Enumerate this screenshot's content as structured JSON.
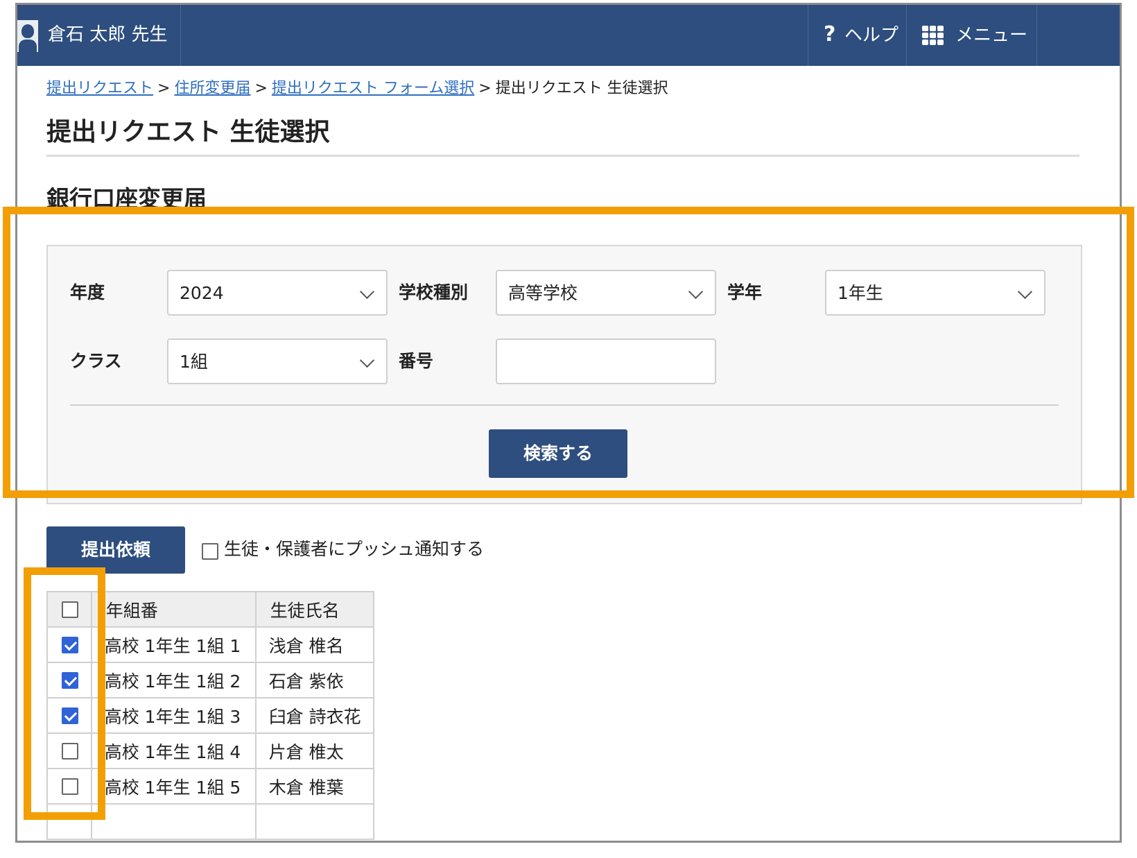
{
  "header": {
    "user_name": "倉石 太郎 先生",
    "help_icon": "?",
    "help_label": "ヘルプ",
    "menu_label": "メニュー"
  },
  "breadcrumb": {
    "items": [
      "提出リクエスト",
      "住所変更届",
      "提出リクエスト フォーム選択"
    ],
    "current": "提出リクエスト 生徒選択",
    "separator": ">"
  },
  "page": {
    "title": "提出リクエスト 生徒選択",
    "form_title": "銀行口座変更届"
  },
  "search": {
    "year_label": "年度",
    "year_value": "2024",
    "school_type_label": "学校種別",
    "school_type_value": "高等学校",
    "grade_label": "学年",
    "grade_value": "1年生",
    "class_label": "クラス",
    "class_value": "1組",
    "number_label": "番号",
    "number_value": "",
    "search_button": "検索する"
  },
  "actions": {
    "submit_button": "提出依頼",
    "push_label": "生徒・保護者にプッシュ通知する",
    "push_checked": false
  },
  "table": {
    "headers": [
      "年組番",
      "生徒氏名"
    ],
    "rows": [
      {
        "class_no": "高校 1年生 1組 1",
        "name": "浅倉 椎名",
        "checked": true
      },
      {
        "class_no": "高校 1年生 1組 2",
        "name": "石倉 紫依",
        "checked": true
      },
      {
        "class_no": "高校 1年生 1組 3",
        "name": "臼倉 詩衣花",
        "checked": true
      },
      {
        "class_no": "高校 1年生 1組 4",
        "name": "片倉 椎太",
        "checked": false
      },
      {
        "class_no": "高校 1年生 1組 5",
        "name": "木倉 椎葉",
        "checked": false
      }
    ]
  },
  "colors": {
    "header_bg": "#2d4e7e",
    "link": "#2f6fbf",
    "highlight": "#f29f05",
    "checkbox_checked": "#2f63d6"
  }
}
